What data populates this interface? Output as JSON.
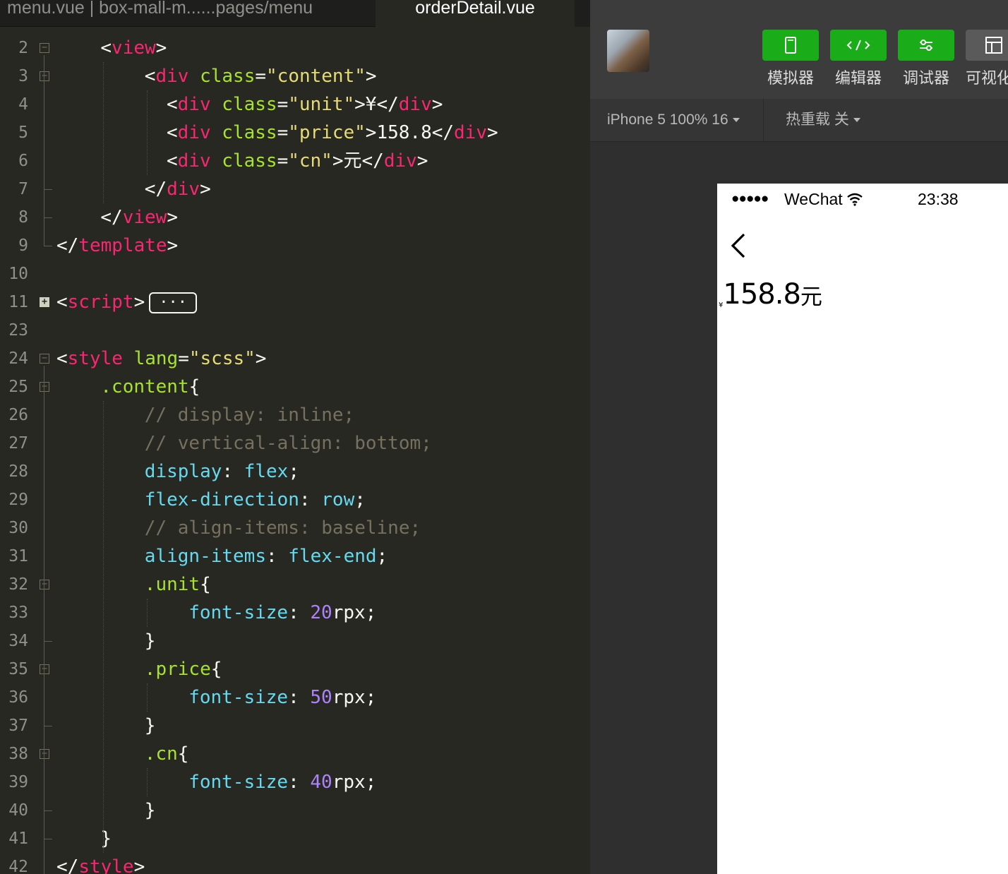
{
  "editor": {
    "tabs": [
      {
        "label": "menu.vue | box-mall-m......pages/menu",
        "active": false
      },
      {
        "label": "orderDetail.vue",
        "active": true
      }
    ],
    "folded_placeholder": "···",
    "lines": [
      {
        "n": "2",
        "fold": "minus",
        "indent": 2,
        "parts": [
          [
            "p",
            "<"
          ],
          [
            "tag",
            "view"
          ],
          [
            "p",
            ">"
          ]
        ]
      },
      {
        "n": "3",
        "fold": "minus",
        "indent": 4,
        "parts": [
          [
            "p",
            "<"
          ],
          [
            "tag",
            "div"
          ],
          [
            "p",
            " "
          ],
          [
            "attr",
            "class"
          ],
          [
            "p",
            "="
          ],
          [
            "str",
            "\"content\""
          ],
          [
            "p",
            ">"
          ]
        ]
      },
      {
        "n": "4",
        "fold": "",
        "indent": 5,
        "parts": [
          [
            "p",
            "<"
          ],
          [
            "tag",
            "div"
          ],
          [
            "p",
            " "
          ],
          [
            "attr",
            "class"
          ],
          [
            "p",
            "="
          ],
          [
            "str",
            "\"unit\""
          ],
          [
            "p",
            ">¥</"
          ],
          [
            "tag",
            "div"
          ],
          [
            "p",
            ">"
          ]
        ]
      },
      {
        "n": "5",
        "fold": "",
        "indent": 5,
        "parts": [
          [
            "p",
            "<"
          ],
          [
            "tag",
            "div"
          ],
          [
            "p",
            " "
          ],
          [
            "attr",
            "class"
          ],
          [
            "p",
            "="
          ],
          [
            "str",
            "\"price\""
          ],
          [
            "p",
            ">158.8</"
          ],
          [
            "tag",
            "div"
          ],
          [
            "p",
            ">"
          ]
        ]
      },
      {
        "n": "6",
        "fold": "",
        "indent": 5,
        "parts": [
          [
            "p",
            "<"
          ],
          [
            "tag",
            "div"
          ],
          [
            "p",
            " "
          ],
          [
            "attr",
            "class"
          ],
          [
            "p",
            "="
          ],
          [
            "str",
            "\"cn\""
          ],
          [
            "p",
            ">元</"
          ],
          [
            "tag",
            "div"
          ],
          [
            "p",
            ">"
          ]
        ]
      },
      {
        "n": "7",
        "fold": "",
        "indent": 4,
        "parts": [
          [
            "p",
            "</"
          ],
          [
            "tag",
            "div"
          ],
          [
            "p",
            ">"
          ]
        ]
      },
      {
        "n": "8",
        "fold": "",
        "indent": 2,
        "parts": [
          [
            "p",
            "</"
          ],
          [
            "tag",
            "view"
          ],
          [
            "p",
            ">"
          ]
        ]
      },
      {
        "n": "9",
        "fold": "",
        "indent": 0,
        "parts": [
          [
            "p",
            "</"
          ],
          [
            "tag",
            "template"
          ],
          [
            "p",
            ">"
          ]
        ]
      },
      {
        "n": "10",
        "fold": "",
        "indent": 0,
        "parts": []
      },
      {
        "n": "11",
        "fold": "plus",
        "indent": 0,
        "parts": [
          [
            "p",
            "<"
          ],
          [
            "tag",
            "script"
          ],
          [
            "p",
            ">"
          ]
        ],
        "collapsed": true
      },
      {
        "n": "23",
        "fold": "",
        "indent": 0,
        "parts": []
      },
      {
        "n": "24",
        "fold": "minus",
        "indent": 0,
        "parts": [
          [
            "p",
            "<"
          ],
          [
            "tag",
            "style"
          ],
          [
            "p",
            " "
          ],
          [
            "attr",
            "lang"
          ],
          [
            "p",
            "="
          ],
          [
            "str",
            "\"scss\""
          ],
          [
            "p",
            ">"
          ]
        ]
      },
      {
        "n": "25",
        "fold": "minus",
        "indent": 2,
        "parts": [
          [
            "attr",
            ".content"
          ],
          [
            "p",
            "{"
          ]
        ]
      },
      {
        "n": "26",
        "fold": "",
        "indent": 4,
        "parts": [
          [
            "com",
            "// display: inline;"
          ]
        ]
      },
      {
        "n": "27",
        "fold": "",
        "indent": 4,
        "parts": [
          [
            "com",
            "// vertical-align: bottom;"
          ]
        ]
      },
      {
        "n": "28",
        "fold": "",
        "indent": 4,
        "parts": [
          [
            "prop",
            "display"
          ],
          [
            "p",
            ": "
          ],
          [
            "prop",
            "flex"
          ],
          [
            "p",
            ";"
          ]
        ]
      },
      {
        "n": "29",
        "fold": "",
        "indent": 4,
        "parts": [
          [
            "prop",
            "flex-direction"
          ],
          [
            "p",
            ": "
          ],
          [
            "prop",
            "row"
          ],
          [
            "p",
            ";"
          ]
        ]
      },
      {
        "n": "30",
        "fold": "",
        "indent": 4,
        "parts": [
          [
            "com",
            "// align-items: baseline;"
          ]
        ]
      },
      {
        "n": "31",
        "fold": "",
        "indent": 4,
        "parts": [
          [
            "prop",
            "align-items"
          ],
          [
            "p",
            ": "
          ],
          [
            "prop",
            "flex-end"
          ],
          [
            "p",
            ";"
          ]
        ]
      },
      {
        "n": "32",
        "fold": "minus",
        "indent": 4,
        "parts": [
          [
            "attr",
            ".unit"
          ],
          [
            "p",
            "{"
          ]
        ]
      },
      {
        "n": "33",
        "fold": "",
        "indent": 6,
        "parts": [
          [
            "prop",
            "font-size"
          ],
          [
            "p",
            ": "
          ],
          [
            "num",
            "20"
          ],
          [
            "p",
            "rpx;"
          ]
        ]
      },
      {
        "n": "34",
        "fold": "",
        "indent": 4,
        "parts": [
          [
            "p",
            "}"
          ]
        ]
      },
      {
        "n": "35",
        "fold": "minus",
        "indent": 4,
        "parts": [
          [
            "attr",
            ".price"
          ],
          [
            "p",
            "{"
          ]
        ]
      },
      {
        "n": "36",
        "fold": "",
        "indent": 6,
        "parts": [
          [
            "prop",
            "font-size"
          ],
          [
            "p",
            ": "
          ],
          [
            "num",
            "50"
          ],
          [
            "p",
            "rpx;"
          ]
        ]
      },
      {
        "n": "37",
        "fold": "",
        "indent": 4,
        "parts": [
          [
            "p",
            "}"
          ]
        ]
      },
      {
        "n": "38",
        "fold": "minus",
        "indent": 4,
        "parts": [
          [
            "attr",
            ".cn"
          ],
          [
            "p",
            "{"
          ]
        ]
      },
      {
        "n": "39",
        "fold": "",
        "indent": 6,
        "parts": [
          [
            "prop",
            "font-size"
          ],
          [
            "p",
            ": "
          ],
          [
            "num",
            "40"
          ],
          [
            "p",
            "rpx;"
          ]
        ]
      },
      {
        "n": "40",
        "fold": "",
        "indent": 4,
        "parts": [
          [
            "p",
            "}"
          ]
        ]
      },
      {
        "n": "41",
        "fold": "",
        "indent": 2,
        "parts": [
          [
            "p",
            "}"
          ]
        ]
      },
      {
        "n": "42",
        "fold": "",
        "indent": 0,
        "parts": [
          [
            "p",
            "</"
          ],
          [
            "tag",
            "style"
          ],
          [
            "p",
            ">"
          ]
        ]
      }
    ]
  },
  "devtool": {
    "toolbar": [
      {
        "label": "模拟器",
        "icon": "phone-icon",
        "style": "green"
      },
      {
        "label": "编辑器",
        "icon": "code-icon",
        "style": "green"
      },
      {
        "label": "调试器",
        "icon": "sliders-icon",
        "style": "green"
      },
      {
        "label": "可视化",
        "icon": "layout-icon",
        "style": "gray"
      }
    ],
    "device_select": "iPhone 5 100% 16",
    "hot_reload_select": "热重载 关"
  },
  "phone": {
    "signal": "●●●●●",
    "carrier": "WeChat",
    "time": "23:38",
    "unit": "¥",
    "price": "158.8",
    "cn": "元"
  },
  "colors": {
    "editor_bg": "#272822",
    "tag": "#f92672",
    "attr": "#a6e22e",
    "string": "#e6db74",
    "property": "#66d9ef",
    "number": "#ae81ff",
    "comment": "#75715e",
    "accent_green": "#1aad19"
  }
}
